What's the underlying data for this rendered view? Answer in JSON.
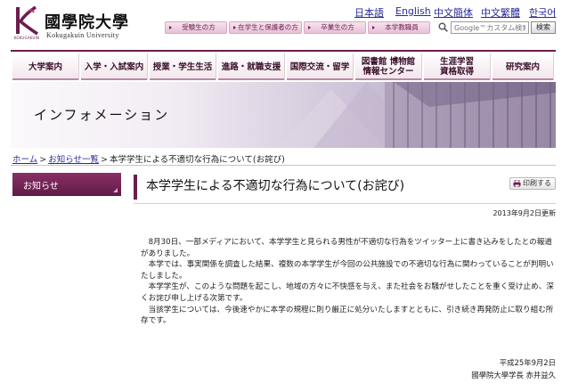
{
  "header": {
    "logo_name": "國學院大學",
    "logo_sub": "Kokugakuin University",
    "logo_mark_text": "KOKUGAKUIN",
    "lang_links": [
      "日本語",
      "English",
      "中文簡体",
      "中文繁體",
      "한국어"
    ],
    "audience_tabs": [
      "受験生の方",
      "在学生と保護者の方",
      "卒業生の方",
      "本学教職員"
    ],
    "search": {
      "placeholder": "Google™カスタム検索",
      "button_label": "検索"
    }
  },
  "main_nav": {
    "items": [
      "大学案内",
      "入学・入試案内",
      "授業・学生生活",
      "進路・就職支援",
      "国際交流・留学",
      "図書館 博物館\n情報センター",
      "生涯学習\n資格取得",
      "研究案内"
    ]
  },
  "hero": {
    "title": "インフォメーション"
  },
  "breadcrumb": {
    "home": "ホーム",
    "news_list": "お知らせ一覧",
    "current": "本学学生による不適切な行為について(お詫び)",
    "separator": ">"
  },
  "sidebar": {
    "label": "お知らせ"
  },
  "article": {
    "title": "本学学生による不適切な行為について(お詫び)",
    "print_label": "印刷する",
    "updated": "2013年9月2日更新",
    "paragraphs": [
      "8月30日、一部メディアにおいて、本学学生と見られる男性が不適切な行為をツイッター上に書き込みをしたとの報道がありました。",
      "本学では、事実関係を調査した結果、複数の本学学生が今回の公共施設での不適切な行為に関わっていることが判明いたしました。",
      "本学学生が、このような問題を起こし、地域の方々に不快感を与え、また社会をお騒がせしたことを重く受け止め、深くお詫び申し上げる次第です。",
      "当該学生については、今後速やかに本学の規程に則り厳正に処分いたしますとともに、引き続き再発防止に取り組む所存です。"
    ],
    "date": "平成25年9月2日",
    "signer": "國學院大學学長 赤井益久"
  },
  "colors": {
    "brand": "#6b1d4f",
    "link": "#2a2a9a"
  }
}
